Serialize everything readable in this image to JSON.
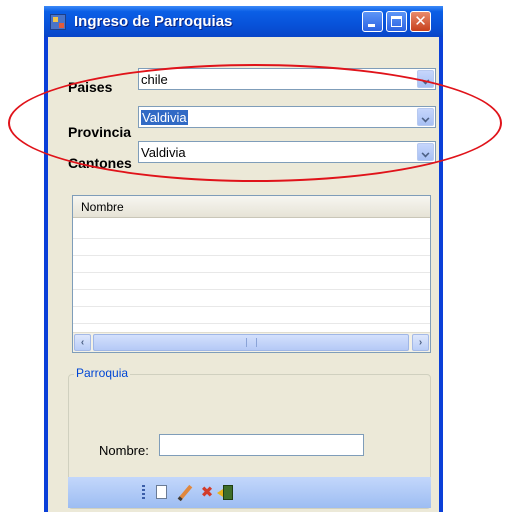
{
  "window": {
    "title": "Ingreso de Parroquias",
    "minimize_symbol": "",
    "maximize_symbol": "",
    "close_symbol": "✕"
  },
  "filters": {
    "paises": {
      "label": "Paises",
      "value": "chile"
    },
    "provincia": {
      "label": "Provincia",
      "value": "Valdivia",
      "selected": true
    },
    "cantones": {
      "label": "Cantones",
      "value": "Valdivia"
    }
  },
  "grid": {
    "columns": [
      "Nombre"
    ],
    "rows": [],
    "scroll_left": "‹",
    "scroll_right": "›"
  },
  "parroquia": {
    "legend": "Parroquia",
    "nombre_label": "Nombre:",
    "nombre_value": ""
  },
  "toolbar": {
    "icons": [
      "new-document-icon",
      "edit-pencil-icon",
      "delete-icon",
      "exit-door-icon"
    ]
  },
  "colors": {
    "title_bar": "#0852d9",
    "client_background": "#ece9d8",
    "annotation": "#e0131a",
    "group_legend": "#0046d5",
    "selection": "#316ac5"
  }
}
